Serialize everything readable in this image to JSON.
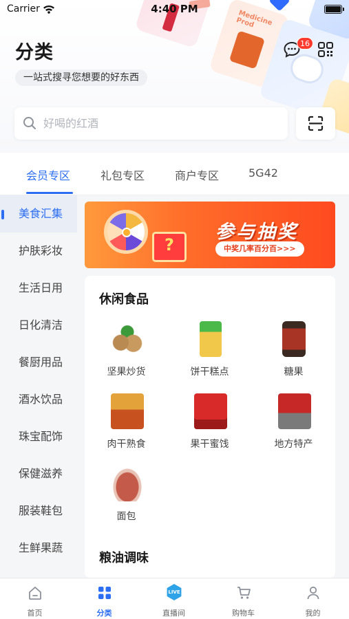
{
  "status_bar": {
    "carrier": "Carrier",
    "time": "4:40 PM"
  },
  "header": {
    "title": "分类",
    "subtitle": "一站式搜寻您想要的好东西",
    "message_badge": "16",
    "deco_text": "Medicine Prod"
  },
  "search": {
    "placeholder": "好喝的红酒"
  },
  "tabs": [
    {
      "label": "会员专区",
      "active": true
    },
    {
      "label": "礼包专区",
      "active": false
    },
    {
      "label": "商户专区",
      "active": false
    },
    {
      "label": "5G42",
      "active": false
    }
  ],
  "sidebar": {
    "items": [
      {
        "label": "美食汇集",
        "active": true
      },
      {
        "label": "护肤彩妆"
      },
      {
        "label": "生活日用"
      },
      {
        "label": "日化清洁"
      },
      {
        "label": "餐厨用品"
      },
      {
        "label": "酒水饮品"
      },
      {
        "label": "珠宝配饰"
      },
      {
        "label": "保健滋养"
      },
      {
        "label": "服装鞋包"
      },
      {
        "label": "生鲜果蔬"
      }
    ]
  },
  "banner": {
    "title": "参与抽奖",
    "subtitle": "中奖几率百分百>>>",
    "gift_mark": "?"
  },
  "sections": [
    {
      "title": "休闲食品",
      "items": [
        {
          "label": "坚果炒货",
          "icon": "nuts-icon"
        },
        {
          "label": "饼干糕点",
          "icon": "biscuit-icon"
        },
        {
          "label": "糖果",
          "icon": "candy-icon"
        },
        {
          "label": "肉干熟食",
          "icon": "jerky-icon"
        },
        {
          "label": "果干蜜饯",
          "icon": "dried-fruit-icon"
        },
        {
          "label": "地方特产",
          "icon": "local-specialty-icon"
        },
        {
          "label": "面包",
          "icon": "bread-icon"
        }
      ]
    },
    {
      "title": "粮油调味",
      "items": []
    }
  ],
  "bottom_nav": [
    {
      "label": "首页",
      "icon": "home-icon"
    },
    {
      "label": "分类",
      "icon": "category-icon",
      "active": true
    },
    {
      "label": "直播间",
      "icon": "live-icon",
      "badge": "LIVE"
    },
    {
      "label": "购物车",
      "icon": "cart-icon"
    },
    {
      "label": "我的",
      "icon": "profile-icon"
    }
  ],
  "colors": {
    "accent": "#2c6ef2",
    "badge": "#ff3b30",
    "banner": "#ff5a22"
  }
}
